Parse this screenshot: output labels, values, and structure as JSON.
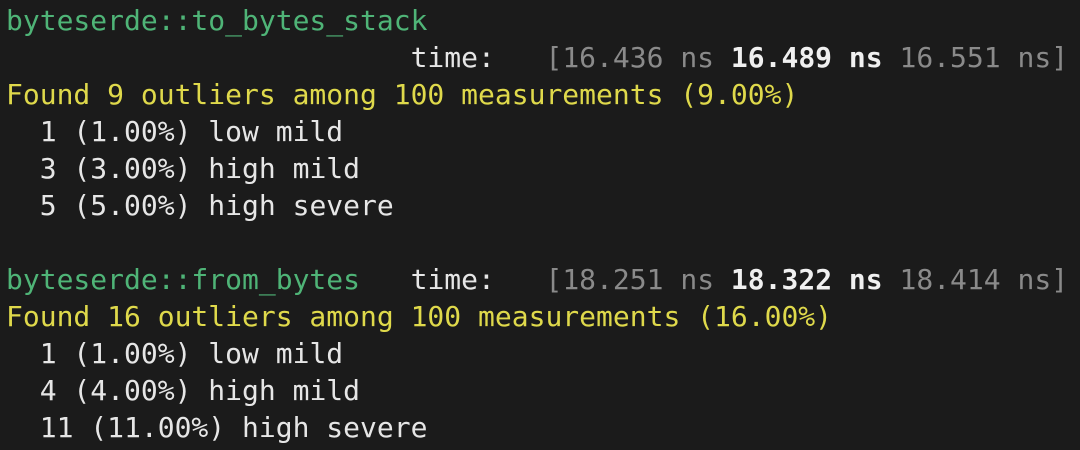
{
  "colors": {
    "background": "#1b1b1b",
    "bench_name": "#4fb477",
    "warning": "#dfd94b",
    "dim": "#8a8a8a",
    "text": "#e6e6e6"
  },
  "benchmarks": [
    {
      "name": "byteserde::to_bytes_stack",
      "time_label": "time:",
      "time_low": "16.436 ns",
      "time_mid": "16.489 ns",
      "time_high": "16.551 ns",
      "outlier_summary": "Found 9 outliers among 100 measurements (9.00%)",
      "outliers": [
        "1 (1.00%) low mild",
        "3 (3.00%) high mild",
        "5 (5.00%) high severe"
      ]
    },
    {
      "name": "byteserde::from_bytes",
      "time_label": "time:",
      "time_low": "18.251 ns",
      "time_mid": "18.322 ns",
      "time_high": "18.414 ns",
      "outlier_summary": "Found 16 outliers among 100 measurements (16.00%)",
      "outliers": [
        "1 (1.00%) low mild",
        "4 (4.00%) high mild",
        "11 (11.00%) high severe"
      ]
    }
  ]
}
